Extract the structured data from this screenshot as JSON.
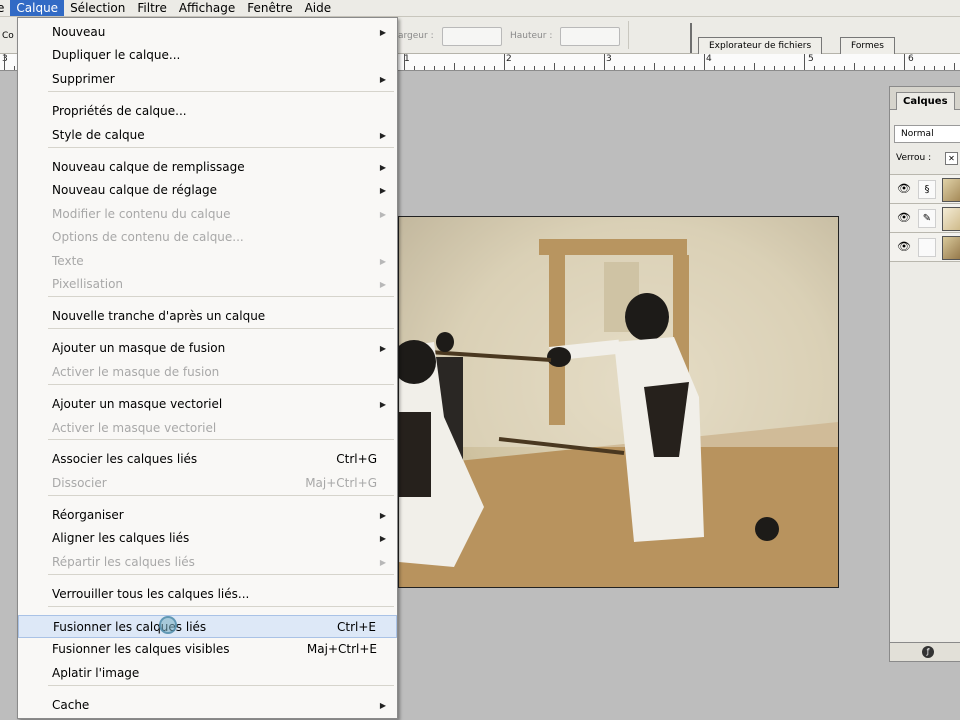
{
  "menubar": {
    "items": [
      "e",
      "Calque",
      "Sélection",
      "Filtre",
      "Affichage",
      "Fenêtre",
      "Aide"
    ],
    "active_index": 1
  },
  "options_bar": {
    "co_label": "Co",
    "largeur_label": "argeur :",
    "hauteur_label": "Hauteur :",
    "palette_tabs": [
      "Explorateur de fichiers",
      "Formes"
    ]
  },
  "ruler": {
    "numbers": [
      "3",
      "1",
      "2",
      "3",
      "4",
      "5",
      "6"
    ]
  },
  "layers_panel": {
    "tab_label": "Calques",
    "blend_mode": "Normal",
    "lock_label": "Verrou :"
  },
  "menu": {
    "items": [
      {
        "label": "Nouveau",
        "submenu": true
      },
      {
        "label": "Dupliquer le calque..."
      },
      {
        "label": "Supprimer",
        "submenu": true
      },
      {
        "label": "Propriétés de calque..."
      },
      {
        "label": "Style de calque",
        "submenu": true
      },
      {
        "label": "Nouveau calque de remplissage",
        "submenu": true
      },
      {
        "label": "Nouveau calque de réglage",
        "submenu": true
      },
      {
        "label": "Modifier le contenu du calque",
        "submenu": true,
        "disabled": true
      },
      {
        "label": "Options de contenu de calque...",
        "disabled": true
      },
      {
        "label": "Texte",
        "submenu": true,
        "disabled": true
      },
      {
        "label": "Pixellisation",
        "submenu": true,
        "disabled": true
      },
      {
        "label": "Nouvelle tranche d'après un calque"
      },
      {
        "label": "Ajouter un masque de fusion",
        "submenu": true
      },
      {
        "label": "Activer le masque de fusion",
        "disabled": true
      },
      {
        "label": "Ajouter un masque vectoriel",
        "submenu": true
      },
      {
        "label": "Activer le masque vectoriel",
        "disabled": true
      },
      {
        "label": "Associer les calques liés",
        "shortcut": "Ctrl+G"
      },
      {
        "label": "Dissocier",
        "shortcut": "Maj+Ctrl+G",
        "disabled": true
      },
      {
        "label": "Réorganiser",
        "submenu": true
      },
      {
        "label": "Aligner les calques liés",
        "submenu": true
      },
      {
        "label": "Répartir les calques liés",
        "submenu": true,
        "disabled": true
      },
      {
        "label": "Verrouiller tous les calques liés..."
      },
      {
        "label": "Fusionner les calques liés",
        "shortcut": "Ctrl+E",
        "highlighted": true
      },
      {
        "label": "Fusionner les calques visibles",
        "shortcut": "Maj+Ctrl+E"
      },
      {
        "label": "Aplatir l'image"
      },
      {
        "label": "Cache",
        "submenu": true
      }
    ]
  },
  "colors": {
    "menu_highlight": "#dde8f7",
    "menubar_active": "#316ac5"
  }
}
